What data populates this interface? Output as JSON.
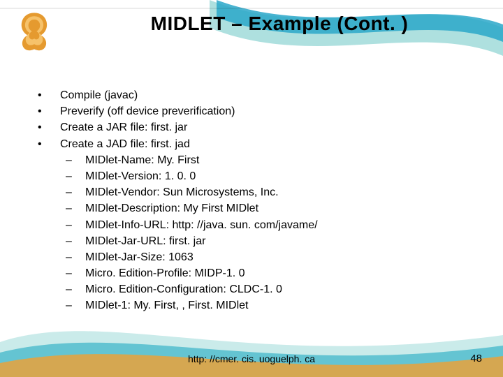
{
  "title": "MIDLET – Example (Cont. )",
  "bullets": [
    "Compile (javac)",
    "Preverify (off device preverification)",
    "Create a JAR file: first. jar",
    "Create a JAD file: first. jad"
  ],
  "subitems": [
    "MIDlet-Name: My. First",
    "MIDlet-Version: 1. 0. 0",
    "MIDlet-Vendor: Sun Microsystems, Inc.",
    "MIDlet-Description: My First MIDlet",
    "MIDlet-Info-URL: http: //java. sun. com/javame/",
    "MIDlet-Jar-URL: first. jar",
    "MIDlet-Jar-Size: 1063",
    "Micro. Edition-Profile: MIDP-1. 0",
    "Micro. Edition-Configuration: CLDC-1. 0",
    "MIDlet-1: My. First, , First. MIDlet"
  ],
  "footer": "http: //cmer. cis. uoguelph. ca",
  "pagenum": "48",
  "bullet_char": "•",
  "dash_char": "–"
}
